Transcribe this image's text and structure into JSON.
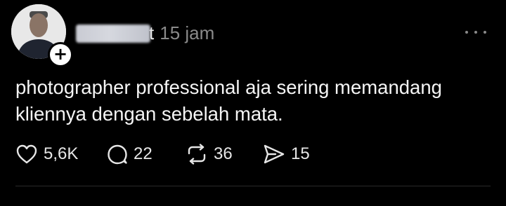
{
  "post": {
    "author": {
      "username_visible_suffix": "t",
      "avatar_icon": "profile-photo",
      "follow_icon": "+"
    },
    "timestamp": "15 jam",
    "more_icon": "more-dots",
    "text_line1": "photographer professional aja sering memandang",
    "text_line2": "kliennya dengan sebelah mata.",
    "stats": {
      "likes": "5,6K",
      "replies": "22",
      "reposts": "36",
      "shares": "15"
    },
    "icons": {
      "like": "heart-icon",
      "reply": "speech-bubble-icon",
      "repost": "repost-icon",
      "share": "send-icon"
    }
  },
  "colors": {
    "background": "#000000",
    "text": "#f5f5f5",
    "muted": "#8a8a8a"
  }
}
